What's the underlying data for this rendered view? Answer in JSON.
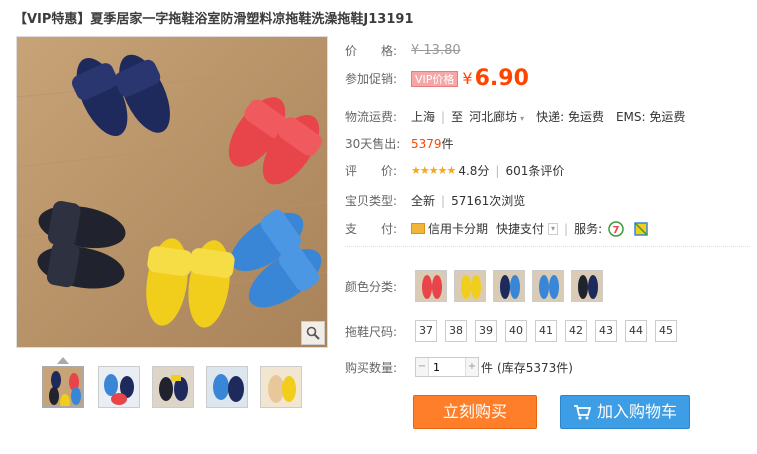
{
  "product": {
    "title": "【VIP特惠】夏季居家一字拖鞋浴室防滑塑料凉拖鞋洗澡拖鞋J13191"
  },
  "price": {
    "label": "价　　格:",
    "original": "¥ 13.80"
  },
  "promo": {
    "label": "参加促销:",
    "badge": "VIP价格",
    "currency": "¥",
    "price": "6.90"
  },
  "shipping": {
    "label": "物流运费:",
    "from": "上海",
    "to_prefix": "至",
    "to": "河北廊坊",
    "express": "快递: 免运费",
    "ems": "EMS: 免运费"
  },
  "sales": {
    "label": "30天售出:",
    "count": "5379",
    "unit": "件"
  },
  "rating": {
    "label": "评　　价:",
    "stars": "★★★★★",
    "score": "4.8分",
    "reviews": "601条评价"
  },
  "type": {
    "label": "宝贝类型:",
    "condition": "全新",
    "views": "57161次浏览"
  },
  "payment": {
    "label": "支　　付:",
    "credit": "信用卡分期",
    "quick": "快捷支付",
    "service_label": "服务:"
  },
  "color": {
    "label": "颜色分类:"
  },
  "sizes": {
    "label": "拖鞋尺码:",
    "options": [
      "37",
      "38",
      "39",
      "40",
      "41",
      "42",
      "43",
      "44",
      "45"
    ]
  },
  "quantity": {
    "label": "购买数量:",
    "value": "1",
    "unit": "件",
    "stock": "(库存5373件)"
  },
  "actions": {
    "buy_now": "立刻购买",
    "add_cart": "加入购物车"
  },
  "colors": {
    "navy": "#1f2a5c",
    "black": "#20232e",
    "red": "#e8454a",
    "blue": "#3a86d6",
    "yellow": "#f1cd1c",
    "accent": "#ff4400"
  }
}
